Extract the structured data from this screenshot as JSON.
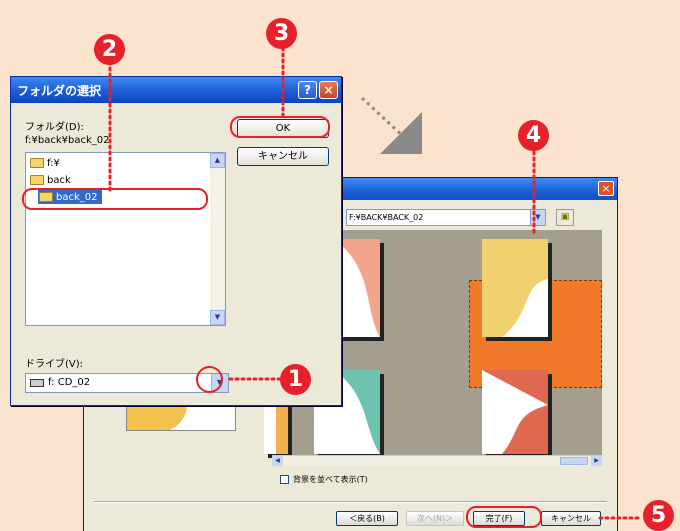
{
  "folder_dialog": {
    "title": "フォルダの選択",
    "help_button": "?",
    "close_button": "×",
    "folder_label": "フォルダ(D):",
    "current_path": "f:¥back¥back_02",
    "tree": [
      {
        "label": "f:¥",
        "selected": false
      },
      {
        "label": "back",
        "selected": false
      },
      {
        "label": "back_02",
        "selected": true
      }
    ],
    "ok_label": "OK",
    "cancel_label": "キャンセル",
    "drive_label": "ドライブ(V):",
    "drive_value": "f: CD_02"
  },
  "back_dialog": {
    "path": "F:¥BACK¥BACK_02",
    "tile_checkbox": "背景を並べて表示(T)",
    "back_button": "＜戻る(B)",
    "next_button": "次へ(N)＞",
    "finish_button": "完了(F)",
    "cancel_button": "キャンセル"
  },
  "callouts": [
    "1",
    "2",
    "3",
    "4",
    "5"
  ],
  "colors": {
    "background": "#fbe3cd",
    "accent_red": "#e8202a",
    "titlebar_blue": "#1e5cd6",
    "selection_orange": "#f07a2a"
  },
  "icons": {
    "folder": "folder-icon",
    "drive": "cd-drive-icon",
    "dropdown": "chevron-down-icon",
    "up_folder": "up-folder-icon"
  }
}
